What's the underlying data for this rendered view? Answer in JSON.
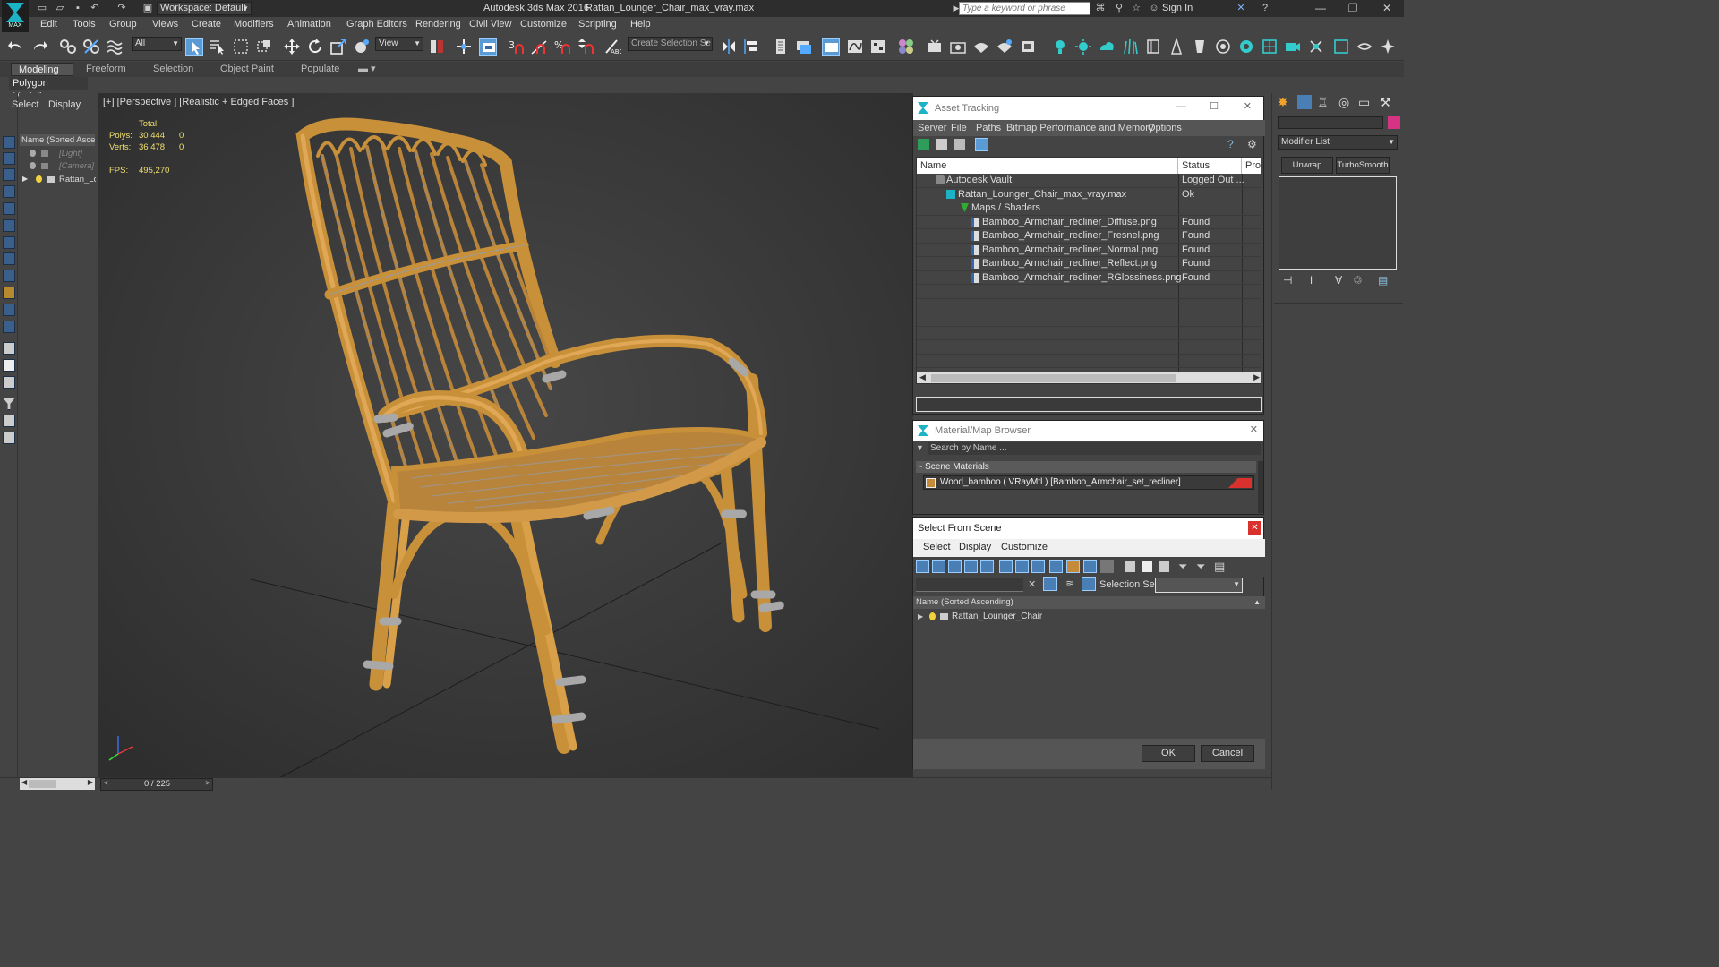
{
  "titlebar": {
    "workspace": "Workspace: Default",
    "app_title": "Autodesk 3ds Max 2016",
    "file_title": "Rattan_Lounger_Chair_max_vray.max",
    "search_placeholder": "Type a keyword or phrase",
    "sign_in": "Sign In",
    "logo_text": "MAX"
  },
  "menubar": [
    "Edit",
    "Tools",
    "Group",
    "Views",
    "Create",
    "Modifiers",
    "Animation",
    "Graph Editors",
    "Rendering",
    "Civil View",
    "Customize",
    "Scripting",
    "Help"
  ],
  "toolbar": {
    "filter_value": "All",
    "view_value": "View",
    "selection_set_placeholder": "Create Selection Se"
  },
  "ribbon": {
    "tabs": [
      "Modeling",
      "Freeform",
      "Selection",
      "Object Paint",
      "Populate"
    ],
    "active_tab": "Modeling",
    "mode_label": "Polygon Modeling"
  },
  "scene_explorer": {
    "tabs": [
      "Select",
      "Display"
    ],
    "header": "Name (Sorted Ascending)",
    "rows": [
      "[Light]",
      "[Camera]",
      "Rattan_Lounger_Chair"
    ]
  },
  "viewport": {
    "label": "[+] [Perspective ] [Realistic + Edged Faces ]",
    "stats": {
      "total_label": "Total",
      "polys_label": "Polys:",
      "polys_value": "30 444",
      "polys_sel": "0",
      "verts_label": "Verts:",
      "verts_value": "36 478",
      "verts_sel": "0",
      "fps_label": "FPS:",
      "fps_value": "495,270"
    }
  },
  "asset_tracking": {
    "title": "Asset Tracking",
    "menu": [
      "Server",
      "File",
      "Paths",
      "Bitmap Performance and Memory",
      "Options"
    ],
    "columns": [
      "Name",
      "Status",
      "Prox"
    ],
    "rows": [
      {
        "name": "Autodesk Vault",
        "status": "Logged Out ..."
      },
      {
        "name": "Rattan_Lounger_Chair_max_vray.max",
        "status": "Ok"
      },
      {
        "name": "Maps / Shaders",
        "status": ""
      },
      {
        "name": "Bamboo_Armchair_recliner_Diffuse.png",
        "status": "Found"
      },
      {
        "name": "Bamboo_Armchair_recliner_Fresnel.png",
        "status": "Found"
      },
      {
        "name": "Bamboo_Armchair_recliner_Normal.png",
        "status": "Found"
      },
      {
        "name": "Bamboo_Armchair_recliner_Reflect.png",
        "status": "Found"
      },
      {
        "name": "Bamboo_Armchair_recliner_RGlossiness.png",
        "status": "Found"
      }
    ]
  },
  "material_browser": {
    "title": "Material/Map Browser",
    "search_placeholder": "Search by Name ...",
    "group_label": "- Scene Materials",
    "material": "Wood_bamboo  ( VRayMtl ) [Bamboo_Armchair_set_recliner]"
  },
  "select_from_scene": {
    "title": "Select From Scene",
    "menu": [
      "Select",
      "Display",
      "Customize"
    ],
    "selection_set_label": "Selection Set:",
    "header": "Name (Sorted Ascending)",
    "rows": [
      "Rattan_Lounger_Chair"
    ],
    "ok": "OK",
    "cancel": "Cancel"
  },
  "command_panel": {
    "modifier_list": "Modifier List",
    "buttons": [
      "Unwrap UVW",
      "TurboSmooth"
    ]
  },
  "timeline": {
    "frame": "0 / 225"
  },
  "colors": {
    "accent": "#1db3c7",
    "rattan": "#d49a3e",
    "close_red": "#d9322e"
  }
}
